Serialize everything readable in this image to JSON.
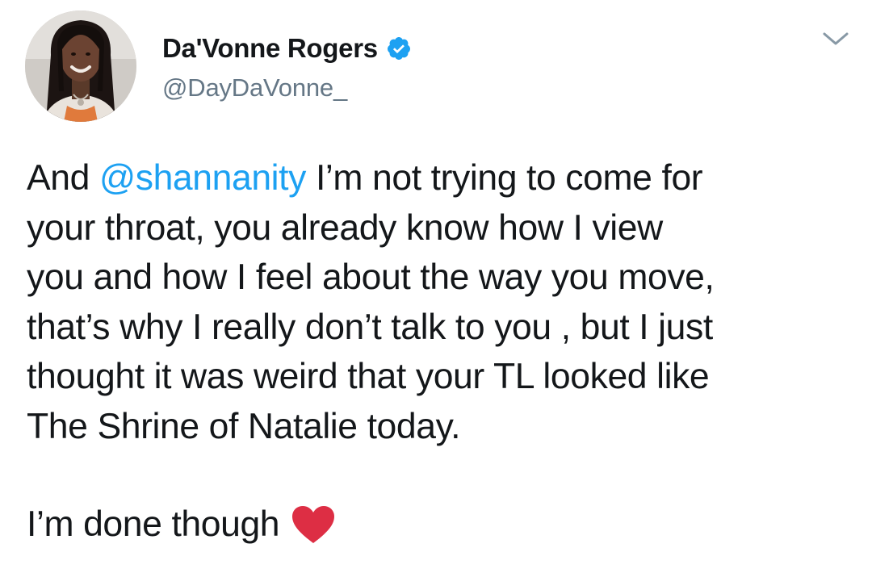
{
  "tweet": {
    "author": {
      "display_name": "Da'Vonne Rogers",
      "handle": "@DayDaVonne_",
      "verified": true,
      "avatar_icon": "profile-photo"
    },
    "menu_icon": "chevron-down-icon",
    "text": {
      "prefix": "And ",
      "mention": "@shannanity",
      "after_mention_line1": " I’m not trying to come for",
      "line2": "your throat, you already know how I view",
      "line3": "you and how I feel about the way you move,",
      "line4": "that’s why I really don’t talk to you , but I just",
      "line5": "thought it was weird that your TL looked like",
      "line6": "The Shrine of Natalie today.",
      "closing": "I’m done though",
      "closing_emoji": "heart-icon"
    }
  },
  "colors": {
    "text": "#14171a",
    "secondary": "#657786",
    "link": "#1da1f2",
    "verified": "#1da1f2",
    "heart": "#dd2e44"
  }
}
